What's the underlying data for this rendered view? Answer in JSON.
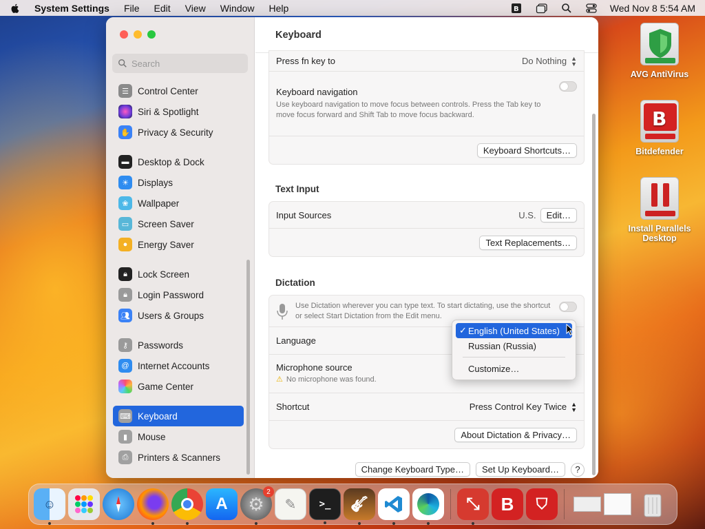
{
  "menubar": {
    "app": "System Settings",
    "items": [
      "File",
      "Edit",
      "View",
      "Window",
      "Help"
    ],
    "clock": "Wed Nov 8  5:54 AM"
  },
  "desktop_icons": [
    {
      "label": "AVG AntiVirus",
      "icon": "avg-shield-icon",
      "color": "#2e9e44"
    },
    {
      "label": "Bitdefender",
      "icon": "bitdefender-icon",
      "color": "#d32222"
    },
    {
      "label": "Install Parallels Desktop",
      "icon": "parallels-icon",
      "color": "#cc2222"
    }
  ],
  "sidebar": {
    "search_placeholder": "Search",
    "items": [
      {
        "label": "Control Center",
        "color": "#8a8a8a",
        "icon": "control-center-icon"
      },
      {
        "label": "Siri & Spotlight",
        "color": "#b43fe0",
        "icon": "siri-icon"
      },
      {
        "label": "Privacy & Security",
        "color": "#3b82f6",
        "icon": "hand-icon"
      },
      {
        "label": "Desktop & Dock",
        "color": "#222222",
        "icon": "desktop-dock-icon"
      },
      {
        "label": "Displays",
        "color": "#2f8cf0",
        "icon": "sun-icon"
      },
      {
        "label": "Wallpaper",
        "color": "#4db8e8",
        "icon": "wallpaper-icon"
      },
      {
        "label": "Screen Saver",
        "color": "#58b7d8",
        "icon": "screen-saver-icon"
      },
      {
        "label": "Energy Saver",
        "color": "#f4b023",
        "icon": "bulb-icon"
      },
      {
        "label": "Lock Screen",
        "color": "#222222",
        "icon": "lock-icon"
      },
      {
        "label": "Login Password",
        "color": "#9a9a9a",
        "icon": "login-lock-icon"
      },
      {
        "label": "Users & Groups",
        "color": "#3b82f6",
        "icon": "users-icon"
      },
      {
        "label": "Passwords",
        "color": "#9a9a9a",
        "icon": "key-icon"
      },
      {
        "label": "Internet Accounts",
        "color": "#2f8cf0",
        "icon": "at-icon"
      },
      {
        "label": "Game Center",
        "color": "#ffffff",
        "icon": "game-center-icon"
      },
      {
        "label": "Keyboard",
        "color": "#a0a0a0",
        "icon": "keyboard-icon"
      },
      {
        "label": "Mouse",
        "color": "#a0a0a0",
        "icon": "mouse-icon"
      },
      {
        "label": "Printers & Scanners",
        "color": "#a0a0a0",
        "icon": "printer-icon"
      }
    ]
  },
  "main": {
    "title": "Keyboard",
    "press_fn": {
      "label": "Press fn key to",
      "value": "Do Nothing"
    },
    "keyboard_nav": {
      "label": "Keyboard navigation",
      "desc": "Use keyboard navigation to move focus between controls. Press the Tab key to move focus forward and Shift Tab to move focus backward."
    },
    "shortcuts_button": "Keyboard Shortcuts…",
    "text_input": {
      "title": "Text Input",
      "sources_label": "Input Sources",
      "sources_value": "U.S.",
      "edit_button": "Edit…",
      "replacements_button": "Text Replacements…"
    },
    "dictation": {
      "title": "Dictation",
      "desc": "Use Dictation wherever you can type text. To start dictating, use the shortcut or select Start Dictation from the Edit menu.",
      "language_label": "Language",
      "mic_label": "Microphone source",
      "mic_warning": "No microphone was found.",
      "shortcut_label": "Shortcut",
      "shortcut_value": "Press Control Key Twice",
      "privacy_button": "About Dictation & Privacy…"
    },
    "change_type_button": "Change Keyboard Type…",
    "setup_button": "Set Up Keyboard…",
    "help_button": "?"
  },
  "language_menu": {
    "options": [
      "English (United States)",
      "Russian (Russia)"
    ],
    "selected": "English (United States)",
    "customize": "Customize…",
    "check": "✓"
  },
  "dock": {
    "badge": "2",
    "apps": [
      "Finder",
      "Launchpad",
      "Safari",
      "Firefox",
      "Chrome",
      "App Store",
      "System Settings",
      "TextEdit",
      "Terminal",
      "GarageBand",
      "VS Code",
      "Edge",
      "Parallels Desktop",
      "Bitdefender",
      "Bitdefender VPN",
      "Trash"
    ]
  }
}
